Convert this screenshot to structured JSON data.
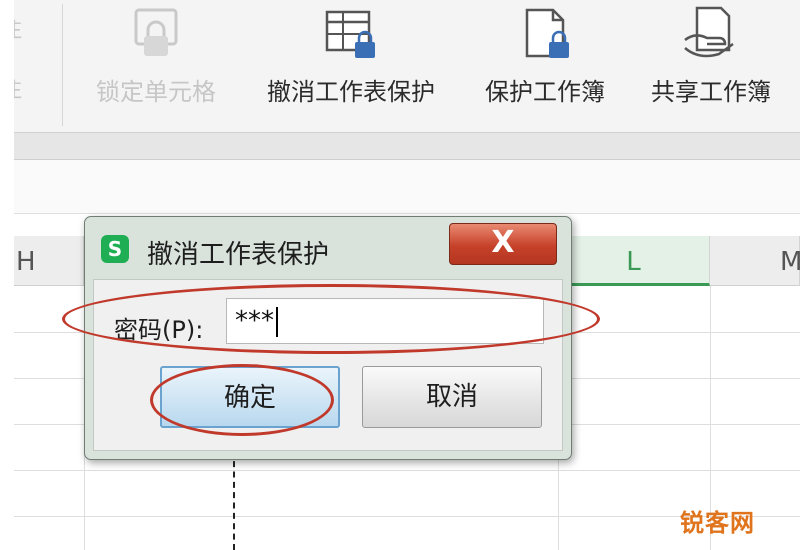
{
  "ribbon": {
    "side_labels": [
      "注",
      "注"
    ],
    "buttons": [
      {
        "label": "锁定单元格",
        "icon": "lock-cell-icon",
        "disabled": true
      },
      {
        "label": "撤消工作表保护",
        "icon": "unprotect-sheet-icon",
        "disabled": false
      },
      {
        "label": "保护工作簿",
        "icon": "protect-workbook-icon",
        "disabled": false
      },
      {
        "label": "共享工作簿",
        "icon": "share-workbook-icon",
        "disabled": false
      }
    ]
  },
  "sheet": {
    "columns": [
      "H",
      "L",
      "M"
    ],
    "selected_column": "L"
  },
  "dialog": {
    "logo": "S",
    "title": "撤消工作表保护",
    "close": "X",
    "password_label": "密码(P):",
    "password_value": "***",
    "ok": "确定",
    "cancel": "取消"
  },
  "colors": {
    "annotation": "#c0392b",
    "accent_green": "#1fae54",
    "selected_column": "#3a9a55"
  },
  "watermark": "锐客网"
}
